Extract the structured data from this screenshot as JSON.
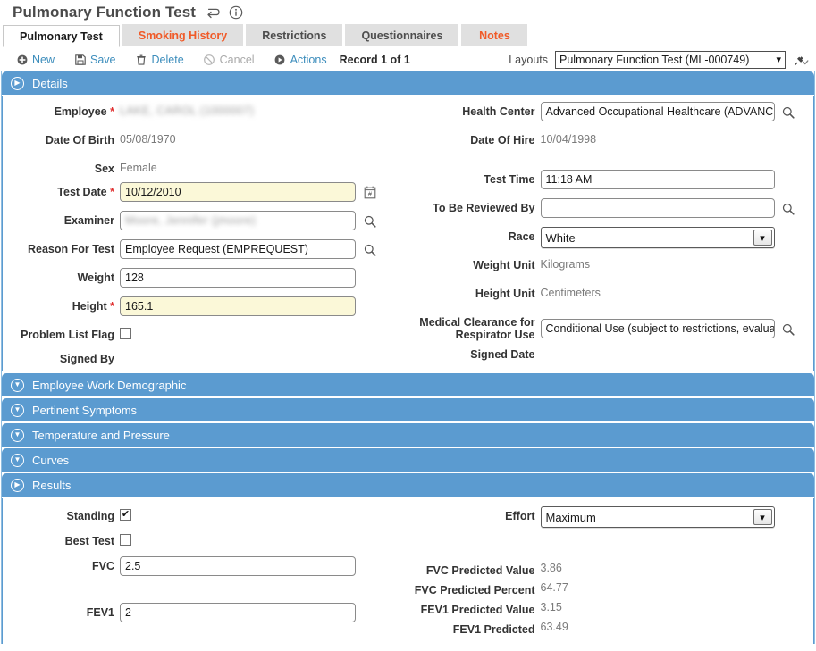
{
  "titlebar": {
    "title": "Pulmonary Function Test",
    "undo_icon": "undo-arrow-icon",
    "info_icon": "info-circle-icon"
  },
  "tabs": [
    {
      "label": "Pulmonary Test",
      "state": "active"
    },
    {
      "label": "Smoking History",
      "state": "orange"
    },
    {
      "label": "Restrictions",
      "state": "normal"
    },
    {
      "label": "Questionnaires",
      "state": "normal"
    },
    {
      "label": "Notes",
      "state": "orange"
    }
  ],
  "toolbar": {
    "new_label": "New",
    "save_label": "Save",
    "delete_label": "Delete",
    "cancel_label": "Cancel",
    "actions_label": "Actions",
    "record_count": "Record 1 of 1",
    "layouts_label": "Layouts",
    "layout_value": "Pulmonary Function Test (ML-000749)",
    "pin_icon": "pin-check-icon"
  },
  "sections": {
    "details": {
      "label": "Details",
      "expanded": true,
      "caret": "▶"
    },
    "employee_work_demographic": {
      "label": "Employee Work Demographic",
      "expanded": false,
      "caret": "▼"
    },
    "pertinent_symptoms": {
      "label": "Pertinent Symptoms",
      "expanded": false,
      "caret": "▼"
    },
    "temperature_and_pressure": {
      "label": "Temperature and Pressure",
      "expanded": false,
      "caret": "▼"
    },
    "curves": {
      "label": "Curves",
      "expanded": false,
      "caret": "▼"
    },
    "results": {
      "label": "Results",
      "expanded": true,
      "caret": "▶"
    }
  },
  "details": {
    "left": {
      "employee_label": "Employee",
      "employee_value": "LAKE, CAROL (1000007)",
      "dob_label": "Date Of Birth",
      "dob_value": "05/08/1970",
      "sex_label": "Sex",
      "sex_value": "Female",
      "test_date_label": "Test Date",
      "test_date_value": "10/12/2010",
      "examiner_label": "Examiner",
      "examiner_value": "Moore, Jennifer (jmoore)",
      "reason_label": "Reason For Test",
      "reason_value": "Employee Request (EMPREQUEST)",
      "weight_label": "Weight",
      "weight_value": "128",
      "height_label": "Height",
      "height_value": "165.1",
      "problem_flag_label": "Problem List Flag",
      "problem_flag_checked": false,
      "signed_by_label": "Signed By",
      "signed_by_value": ""
    },
    "right": {
      "health_center_label": "Health Center",
      "health_center_value": "Advanced Occupational Healthcare (ADVANCE",
      "date_of_hire_label": "Date Of Hire",
      "date_of_hire_value": "10/04/1998",
      "test_time_label": "Test Time",
      "test_time_value": "11:18 AM",
      "reviewed_by_label": "To Be Reviewed By",
      "reviewed_by_value": "",
      "race_label": "Race",
      "race_value": "White",
      "weight_unit_label": "Weight Unit",
      "weight_unit_value": "Kilograms",
      "height_unit_label": "Height Unit",
      "height_unit_value": "Centimeters",
      "clearance_label": "Medical Clearance for Respirator Use",
      "clearance_value": "Conditional Use (subject to restrictions, evaluati",
      "signed_date_label": "Signed Date",
      "signed_date_value": ""
    }
  },
  "results": {
    "left": {
      "standing_label": "Standing",
      "standing_checked": true,
      "best_test_label": "Best Test",
      "best_test_checked": false,
      "fvc_label": "FVC",
      "fvc_value": "2.5",
      "fev1_label": "FEV1",
      "fev1_value": "2"
    },
    "right": {
      "effort_label": "Effort",
      "effort_value": "Maximum",
      "fvc_pred_value_label": "FVC Predicted Value",
      "fvc_pred_value": "3.86",
      "fvc_pred_pct_label": "FVC Predicted Percent",
      "fvc_pred_pct": "64.77",
      "fev1_pred_value_label": "FEV1 Predicted Value",
      "fev1_pred_value": "3.15",
      "fev1_pred_label": "FEV1 Predicted",
      "fev1_pred": "63.49"
    }
  },
  "icons": {
    "new": "plus-circle-icon",
    "save": "floppy-disk-icon",
    "delete": "trash-icon",
    "cancel": "cancel-circle-icon",
    "actions": "play-circle-icon",
    "search": "magnifier-icon",
    "calendar": "calendar-icon",
    "checkmark": "✔"
  },
  "colors": {
    "section_blue": "#5b9bd0",
    "tab_orange": "#f05a28",
    "link_blue": "#3c8dbc",
    "required_red": "#e03030",
    "required_field_bg": "#fbf8d8"
  }
}
